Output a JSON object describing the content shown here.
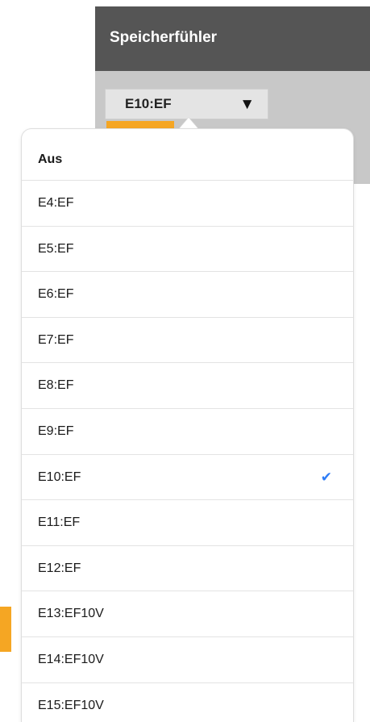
{
  "header": {
    "title": "Speicherfühler"
  },
  "select": {
    "value": "E10:EF",
    "caret": "▼"
  },
  "dropdown": {
    "options": [
      {
        "label": "Aus",
        "selected": false
      },
      {
        "label": "E4:EF",
        "selected": false
      },
      {
        "label": "E5:EF",
        "selected": false
      },
      {
        "label": "E6:EF",
        "selected": false
      },
      {
        "label": "E7:EF",
        "selected": false
      },
      {
        "label": "E8:EF",
        "selected": false
      },
      {
        "label": "E9:EF",
        "selected": false
      },
      {
        "label": "E10:EF",
        "selected": true
      },
      {
        "label": "E11:EF",
        "selected": false
      },
      {
        "label": "E12:EF",
        "selected": false
      },
      {
        "label": "E13:EF10V",
        "selected": false
      },
      {
        "label": "E14:EF10V",
        "selected": false
      },
      {
        "label": "E15:EF10V",
        "selected": false
      }
    ],
    "check_glyph": "✔"
  },
  "colors": {
    "header_bg": "#555555",
    "accent_orange": "#f5a623",
    "check_blue": "#2d7cf6"
  }
}
